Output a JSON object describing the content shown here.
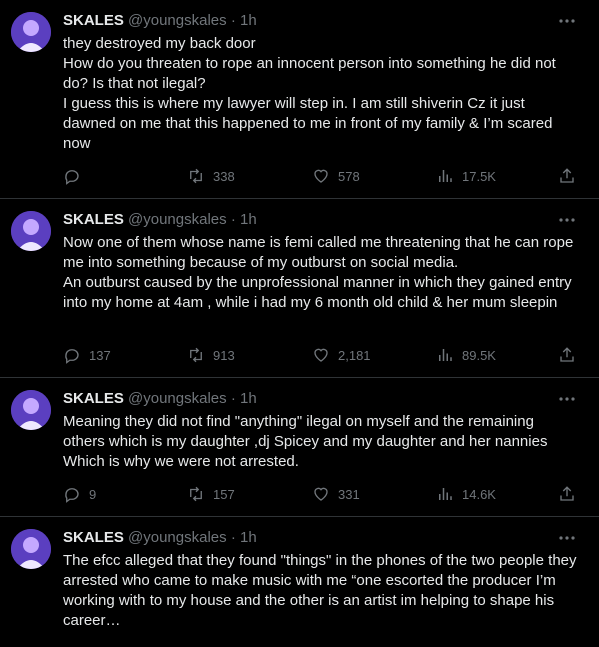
{
  "tweets": [
    {
      "name": "SKALES",
      "handle": "@youngskales",
      "sep": "·",
      "time": "1h",
      "lines": [
        "they destroyed my back door",
        "How do you threaten to rope an innocent person into something he did not do? Is that not ilegal?",
        "I guess this is where my lawyer will step in. I am still shiverin Cz it just dawned on me that this happened to me in front of my family & I’m scared now"
      ],
      "replies": "",
      "retweets": "338",
      "likes": "578",
      "views": "17.5K"
    },
    {
      "name": "SKALES",
      "handle": "@youngskales",
      "sep": "·",
      "time": "1h",
      "lines": [
        "Now one of them whose name is femi called me threatening that he can rope me into something because of my outburst on social media.",
        "An outburst caused by the unprofessional manner in which they gained entry into my home at 4am , while i had my 6 month old child & her mum sleepin"
      ],
      "replies": "137",
      "retweets": "913",
      "likes": "2,181",
      "views": "89.5K"
    },
    {
      "name": "SKALES",
      "handle": "@youngskales",
      "sep": "·",
      "time": "1h",
      "lines": [
        "Meaning they did not find \"anything\" ilegal on myself and the remaining others which is my daughter ,dj Spicey and my daughter and her nannies Which is why we were not arrested."
      ],
      "replies": "9",
      "retweets": "157",
      "likes": "331",
      "views": "14.6K"
    },
    {
      "name": "SKALES",
      "handle": "@youngskales",
      "sep": "·",
      "time": "1h",
      "lines": [
        "The efcc alleged that they found \"things\" in the phones of the two people they arrested who came to make music with me “one escorted the producer I’m working with to my house and the other is an artist im helping to shape his career…"
      ]
    }
  ],
  "icons": {
    "reply": "reply-icon",
    "retweet": "retweet-icon",
    "like": "like-icon",
    "views": "views-icon",
    "share": "share-icon",
    "more": "more-icon"
  },
  "colors": {
    "background": "#000000",
    "text": "#e7e9ea",
    "muted": "#71767b",
    "divider": "#2f3336",
    "avatar": "#6a4bc8"
  }
}
